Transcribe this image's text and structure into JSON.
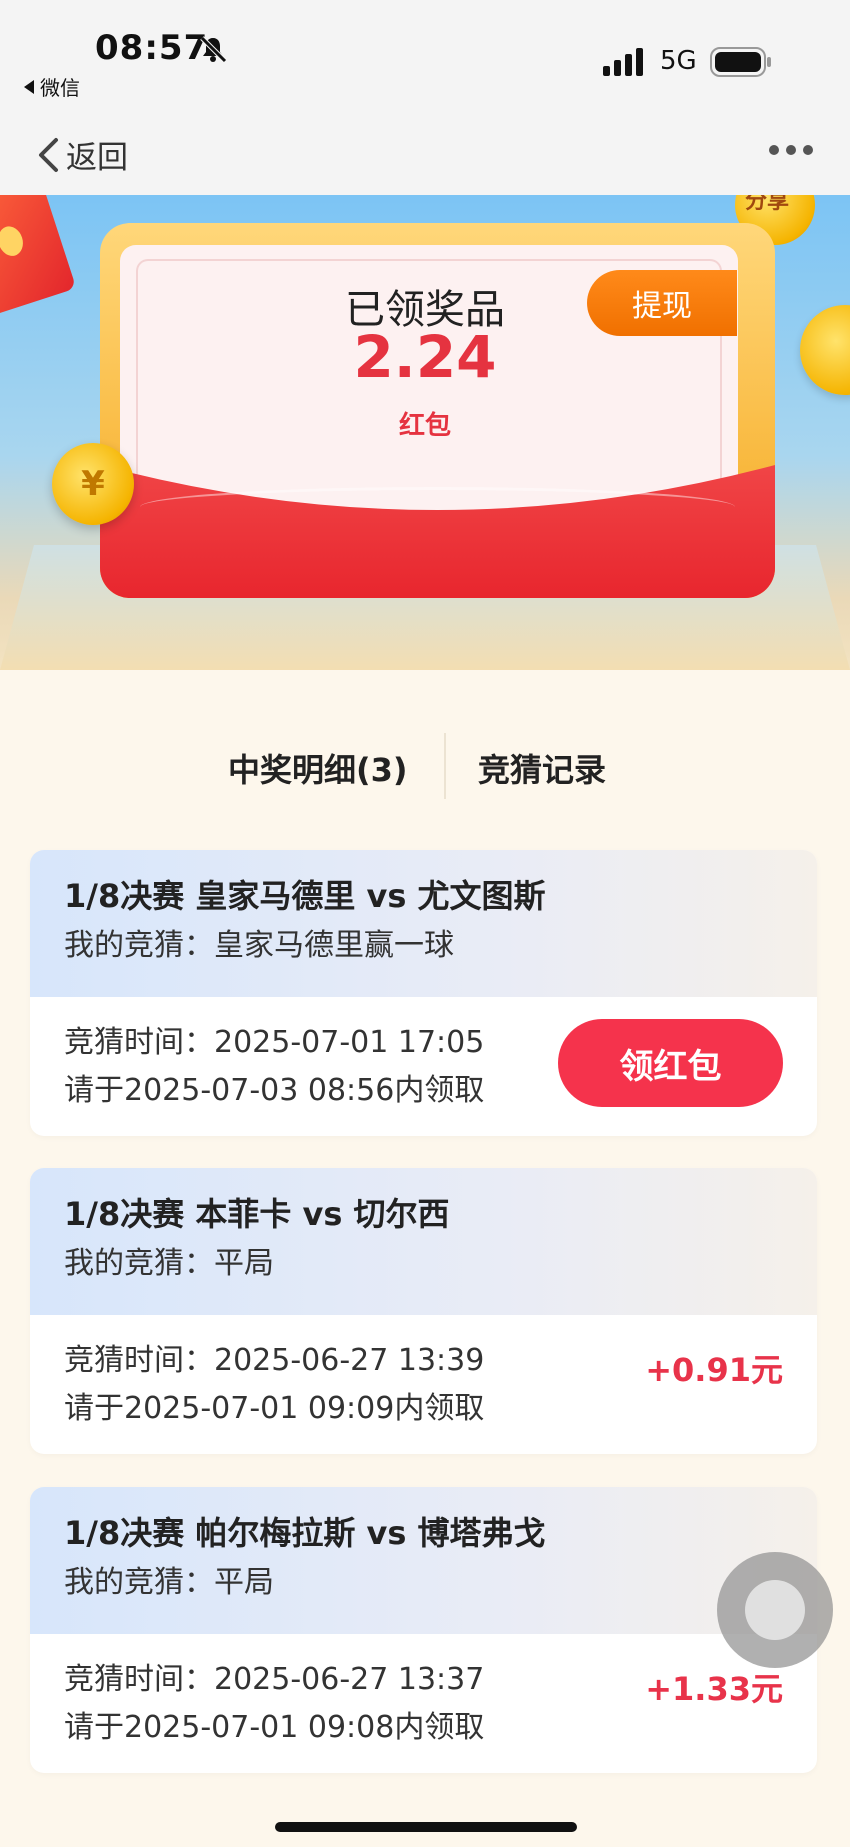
{
  "status_bar": {
    "time": "08:57",
    "back_app": "微信",
    "network": "5G"
  },
  "nav": {
    "back_label": "返回"
  },
  "hero": {
    "title": "已领奖品",
    "amount": "2.24",
    "unit": "红包",
    "withdraw_label": "提现",
    "share_badge": "分享"
  },
  "tabs": [
    {
      "label": "中奖明细(3)"
    },
    {
      "label": "竞猜记录"
    }
  ],
  "records": [
    {
      "match": "1/8决赛 皇家马德里 vs 尤文图斯",
      "guess": "我的竞猜：皇家马德里赢一球",
      "time": "竞猜时间：2025-07-01 17:05",
      "deadline": "请于2025-07-03 08:56内领取",
      "action_label": "领红包"
    },
    {
      "match": "1/8决赛 本菲卡 vs 切尔西",
      "guess": "我的竞猜：平局",
      "time": "竞猜时间：2025-06-27 13:39",
      "deadline": "请于2025-07-01 09:09内领取",
      "reward": "+0.91元"
    },
    {
      "match": "1/8决赛 帕尔梅拉斯 vs 博塔弗戈",
      "guess": "我的竞猜：平局",
      "time": "竞猜时间：2025-06-27 13:37",
      "deadline": "请于2025-07-01 09:08内领取",
      "reward": "+1.33元"
    }
  ],
  "colors": {
    "accent_red": "#e53340",
    "button_red": "#f5334c",
    "withdraw_orange": "#f07000"
  }
}
